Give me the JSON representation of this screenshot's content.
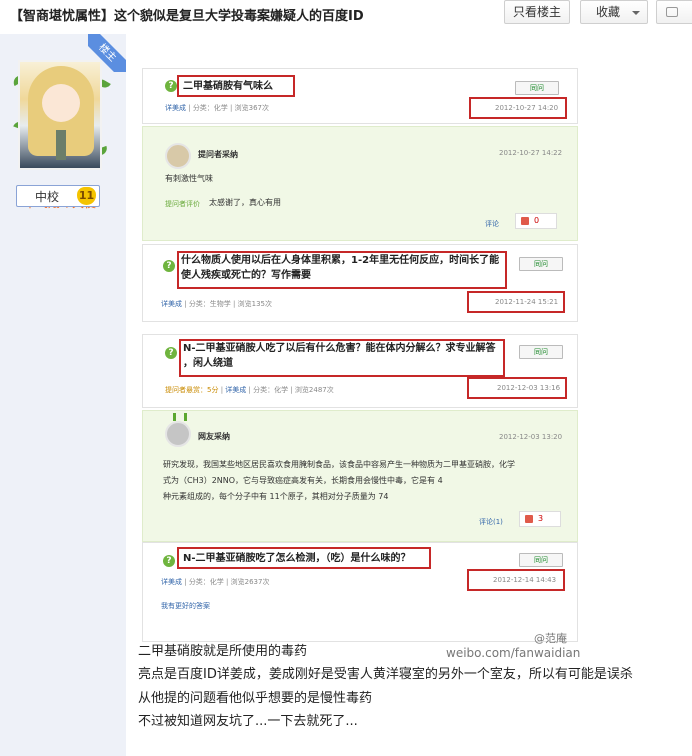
{
  "header": {
    "title": "【智商堪忧属性】这个貌似是复旦大学投毒案嫌疑人的百度ID",
    "only_poster_label": "只看楼主",
    "favorite_label": "收藏",
    "reply_label": "回"
  },
  "author": {
    "poster_badge": "楼主",
    "name": "不飞翔の天使",
    "level_name": "中校",
    "level_num": "11"
  },
  "screenshot": {
    "q1": {
      "title": "二甲基硝胺有气味么",
      "user": "详美成",
      "category": "分类：化学",
      "views": "浏览367次",
      "ask_btn": "同问",
      "date": "2012-10-27 14:20",
      "answer": {
        "badge": "提问者采纳",
        "date": "2012-10-27 14:22",
        "text": "有刺激性气味",
        "evaluation_label": "提问者评价",
        "evaluation": "太感谢了，真心有用",
        "comment_label": "评论",
        "likes": "0"
      }
    },
    "q2": {
      "title_line1": "什么物质人使用以后在人身体里积累，1-2年里无任何反应，时间长了能",
      "title_line2": "使人残疾或死亡的？写作需要",
      "user": "详美成",
      "category": "分类：生物学",
      "views": "浏览135次",
      "ask_btn": "同问",
      "date": "2012-11-24 15:21"
    },
    "q3": {
      "title_line1": "N-二甲基亚硝胺人吃了以后有什么危害？能在体内分解么？求专业解答",
      "title_line2": "，闲人绕道",
      "reward": "提问者悬赏：5分",
      "user": "详美成",
      "category": "分类：化学",
      "views": "浏览2487次",
      "ask_btn": "同问",
      "date": "2012-12-03 13:16",
      "answer": {
        "badge": "网友采纳",
        "date": "2012-12-03 13:20",
        "text_line1": "研究发现，我国某些地区居民喜欢食用腌制食品，该食品中容易产生一种物质为二甲基亚硝胺，化学",
        "text_line2": "式为（CH3）2NNO，它与导致癌症高发有关，长期食用会慢性中毒，它是有 4",
        "text_line3": "种元素组成的，每个分子中有 11个原子，其相对分子质量为 74",
        "comment_label": "评论(1)",
        "likes": "3"
      }
    },
    "q4": {
      "title": "N-二甲基亚硝胺吃了怎么检测，（吃）是什么味的？",
      "user": "详美成",
      "category": "分类：化学",
      "views": "浏览2637次",
      "ask_btn": "同问",
      "date": "2012-12-14 14:43",
      "better_answer": "我有更好的答案"
    },
    "watermark_name": "@范庵",
    "watermark_url": "weibo.com/fanwaidian"
  },
  "post_body": [
    "二甲基硝胺就是所使用的毒药",
    "亮点是百度ID详姜成，姜成刚好是受害人黄洋寝室的另外一个室友，所以有可能是误杀",
    "从他提的问题看他似乎想要的是慢性毒药",
    "不过被知道网友坑了...一下去就死了..."
  ],
  "colors": {
    "sidebar_bg": "#eef1f8",
    "username": "#f06a23",
    "highlight_border": "#c62828",
    "answer_bg": "#f1f8e6",
    "accent_green": "#6fb43e"
  }
}
